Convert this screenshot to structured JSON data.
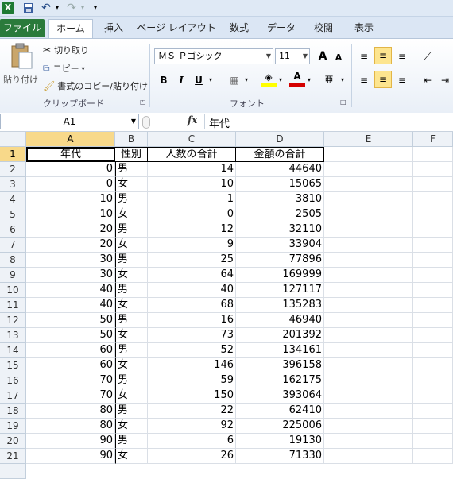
{
  "quick_access": {
    "excel_icon": "excel-icon",
    "save_icon": "save-icon",
    "undo_icon": "undo-icon",
    "redo_icon": "redo-icon",
    "customize_icon": "customize-icon"
  },
  "tabs": [
    "ファイル",
    "ホーム",
    "挿入",
    "ページ レイアウト",
    "数式",
    "データ",
    "校閲",
    "表示"
  ],
  "ribbon": {
    "clipboard": {
      "paste_label": "貼り付け",
      "cut_label": "切り取り",
      "copy_label": "コピー",
      "format_painter_label": "書式のコピー/貼り付け",
      "group_label": "クリップボード"
    },
    "font": {
      "font_name": "ＭＳ Ｐゴシック",
      "font_size": "11",
      "grow_label": "A",
      "shrink_label": "A",
      "bold_label": "B",
      "italic_label": "I",
      "underline_label": "U",
      "font_color_label": "A",
      "group_label": "フォント"
    }
  },
  "formula_bar": {
    "name_box": "A1",
    "fx_label": "fx",
    "formula": "年代"
  },
  "columns": [
    "A",
    "B",
    "C",
    "D",
    "E",
    "F"
  ],
  "header_row": [
    "年代",
    "性別",
    "人数の合計",
    "金額の合計"
  ],
  "rows": [
    {
      "row": "2",
      "age": "0",
      "sex": "男",
      "count": "14",
      "amount": "44640"
    },
    {
      "row": "3",
      "age": "0",
      "sex": "女",
      "count": "10",
      "amount": "15065"
    },
    {
      "row": "4",
      "age": "10",
      "sex": "男",
      "count": "1",
      "amount": "3810"
    },
    {
      "row": "5",
      "age": "10",
      "sex": "女",
      "count": "0",
      "amount": "2505"
    },
    {
      "row": "6",
      "age": "20",
      "sex": "男",
      "count": "12",
      "amount": "32110"
    },
    {
      "row": "7",
      "age": "20",
      "sex": "女",
      "count": "9",
      "amount": "33904"
    },
    {
      "row": "8",
      "age": "30",
      "sex": "男",
      "count": "25",
      "amount": "77896"
    },
    {
      "row": "9",
      "age": "30",
      "sex": "女",
      "count": "64",
      "amount": "169999"
    },
    {
      "row": "10",
      "age": "40",
      "sex": "男",
      "count": "40",
      "amount": "127117"
    },
    {
      "row": "11",
      "age": "40",
      "sex": "女",
      "count": "68",
      "amount": "135283"
    },
    {
      "row": "12",
      "age": "50",
      "sex": "男",
      "count": "16",
      "amount": "46940"
    },
    {
      "row": "13",
      "age": "50",
      "sex": "女",
      "count": "73",
      "amount": "201392"
    },
    {
      "row": "14",
      "age": "60",
      "sex": "男",
      "count": "52",
      "amount": "134161"
    },
    {
      "row": "15",
      "age": "60",
      "sex": "女",
      "count": "146",
      "amount": "396158"
    },
    {
      "row": "16",
      "age": "70",
      "sex": "男",
      "count": "59",
      "amount": "162175"
    },
    {
      "row": "17",
      "age": "70",
      "sex": "女",
      "count": "150",
      "amount": "393064"
    },
    {
      "row": "18",
      "age": "80",
      "sex": "男",
      "count": "22",
      "amount": "62410"
    },
    {
      "row": "19",
      "age": "80",
      "sex": "女",
      "count": "92",
      "amount": "225006"
    },
    {
      "row": "20",
      "age": "90",
      "sex": "男",
      "count": "6",
      "amount": "19130"
    },
    {
      "row": "21",
      "age": "90",
      "sex": "女",
      "count": "26",
      "amount": "71330"
    }
  ],
  "first_row_number": "1",
  "colors": {
    "file_tab": "#2a7a3b",
    "selection": "#f8d98a",
    "font_color": "#d40000",
    "highlight": "#ffff00"
  }
}
